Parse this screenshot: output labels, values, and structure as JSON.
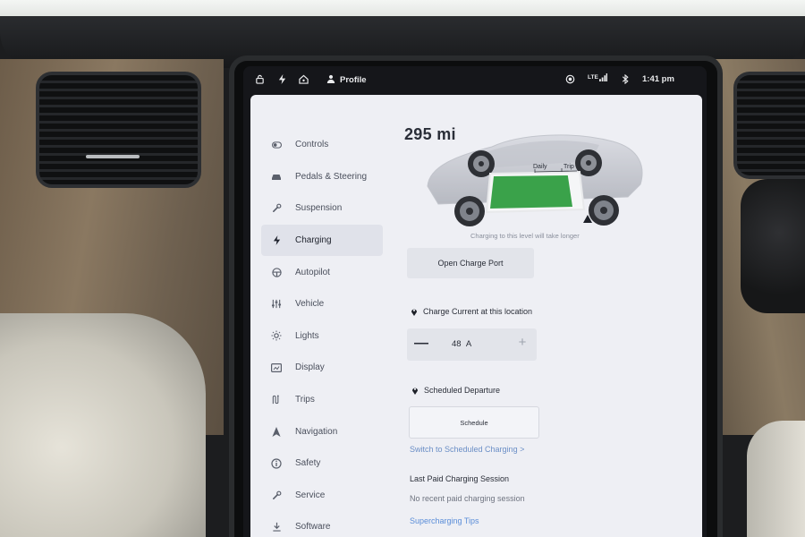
{
  "status_bar": {
    "profile_label": "Profile",
    "network": "LTE",
    "time": "1:41 pm",
    "icons": [
      "lock-icon",
      "bolt-icon",
      "homelink-icon",
      "person-icon",
      "camera-icon",
      "signal-icon",
      "bluetooth-icon"
    ]
  },
  "sidebar": {
    "items": [
      {
        "label": "Controls",
        "icon": "toggle-icon",
        "active": false
      },
      {
        "label": "Pedals & Steering",
        "icon": "car-icon",
        "active": false
      },
      {
        "label": "Suspension",
        "icon": "wrench-icon",
        "active": false
      },
      {
        "label": "Charging",
        "icon": "bolt-icon",
        "active": true
      },
      {
        "label": "Autopilot",
        "icon": "steering-wheel-icon",
        "active": false
      },
      {
        "label": "Vehicle",
        "icon": "sliders-icon",
        "active": false
      },
      {
        "label": "Lights",
        "icon": "sun-icon",
        "active": false
      },
      {
        "label": "Display",
        "icon": "display-icon",
        "active": false
      },
      {
        "label": "Trips",
        "icon": "trips-icon",
        "active": false
      },
      {
        "label": "Navigation",
        "icon": "navigation-arrow-icon",
        "active": false
      },
      {
        "label": "Safety",
        "icon": "info-circle-icon",
        "active": false
      },
      {
        "label": "Service",
        "icon": "wrench-icon",
        "active": false
      },
      {
        "label": "Software",
        "icon": "download-icon",
        "active": false
      }
    ]
  },
  "charging": {
    "range": "295 mi",
    "charge_limit_fraction": 0.9,
    "limit_labels": {
      "daily": "Daily",
      "trip": "Trip"
    },
    "charge_note": "Charging to this level will take longer",
    "open_charge_port_label": "Open Charge Port",
    "charge_current_title": "Charge Current at this location",
    "charge_current_value": "48",
    "charge_current_unit": "A",
    "minus_label": "—",
    "plus_label": "+",
    "scheduled_departure_title": "Scheduled Departure",
    "schedule_button_label": "Schedule",
    "switch_link": "Switch to Scheduled Charging >",
    "last_paid_title": "Last Paid Charging Session",
    "last_paid_value": "No recent paid charging session",
    "supercharging_tips": "Supercharging Tips"
  },
  "colors": {
    "battery_fill": "#3aa24a",
    "link": "#5a8dd8",
    "panel": "#eeeff4"
  }
}
